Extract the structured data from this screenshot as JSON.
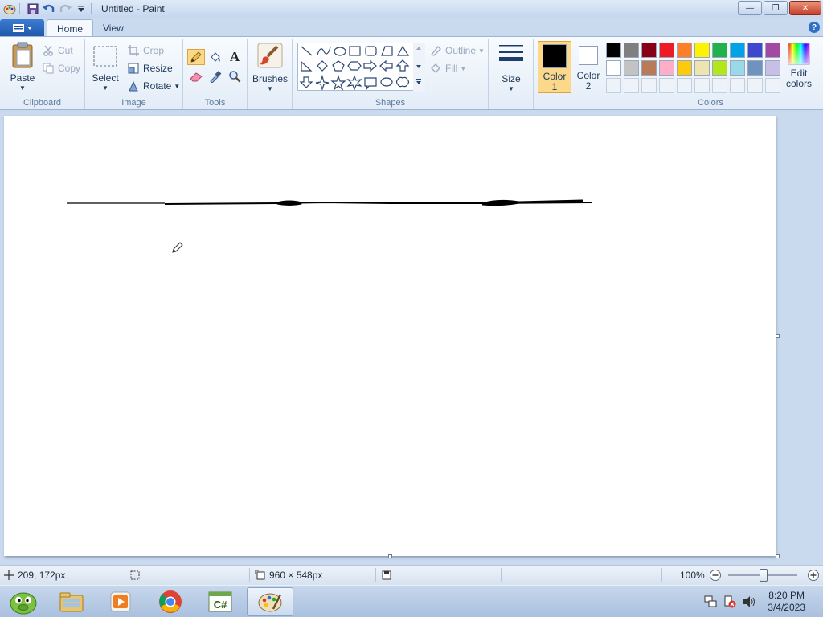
{
  "window": {
    "title": "Untitled - Paint",
    "minimize": "—",
    "restore": "❐",
    "close": "✕"
  },
  "tabs": [
    {
      "label": "Home",
      "active": true
    },
    {
      "label": "View",
      "active": false
    }
  ],
  "ribbon": {
    "clipboard": {
      "label": "Clipboard",
      "paste": "Paste",
      "cut": "Cut",
      "copy": "Copy"
    },
    "image": {
      "label": "Image",
      "select": "Select",
      "crop": "Crop",
      "resize": "Resize",
      "rotate": "Rotate"
    },
    "tools": {
      "label": "Tools",
      "text_tool": "A"
    },
    "brushes": {
      "label": "Brushes"
    },
    "shapes": {
      "label": "Shapes",
      "outline": "Outline",
      "fill": "Fill"
    },
    "size": {
      "label": "Size"
    },
    "colors": {
      "label": "Colors",
      "color1": "Color\n1",
      "color1_line1": "Color",
      "color1_line2": "1",
      "color2_line1": "Color",
      "color2_line2": "2",
      "edit_line1": "Edit",
      "edit_line2": "colors",
      "color1_value": "#000000",
      "color2_value": "#ffffff",
      "palette_row1": [
        "#000000",
        "#7f7f7f",
        "#880015",
        "#ed1c24",
        "#ff7f27",
        "#fff200",
        "#22b14c",
        "#00a2e8",
        "#3f48cc",
        "#a349a4"
      ],
      "palette_row2": [
        "#ffffff",
        "#c3c3c3",
        "#b97a57",
        "#ffaec9",
        "#ffc90e",
        "#efe4b0",
        "#b5e61d",
        "#99d9ea",
        "#7092be",
        "#c8bfe7"
      ]
    }
  },
  "status": {
    "cursor_pos": "209, 172px",
    "canvas_size": "960 × 548px",
    "zoom": "100%"
  },
  "taskbar": {
    "time": "8:20 PM",
    "date": "3/4/2023"
  }
}
